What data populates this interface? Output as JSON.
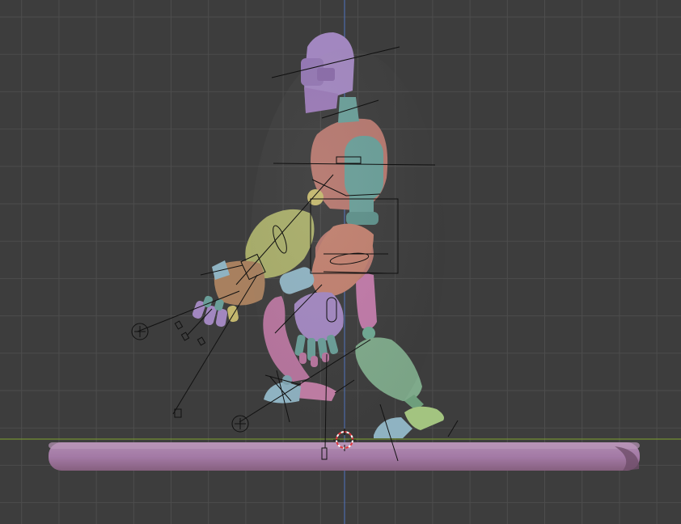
{
  "viewport": {
    "type": "3d-viewport",
    "view": "side-orthographic",
    "grid": true,
    "objects": [
      {
        "name": "robot-character",
        "icon": "armature"
      },
      {
        "name": "display-platform"
      }
    ],
    "cursor": {
      "icon": "3d-cursor-icon"
    }
  },
  "colors": {
    "background": "#3d3d3d",
    "grid": "#4d4d4d",
    "z_axis": "#4f73c0",
    "y_axis": "#7fa32e",
    "purple": "#9e7ab5",
    "teal": "#6a9e98",
    "salmon": "#b5786f",
    "olive": "#a8ad6a",
    "tan": "#a8805f",
    "pink": "#b7759e",
    "lilac": "#a287c0",
    "sky": "#8fb3c2",
    "green": "#7faa8b",
    "lime": "#a3c480",
    "platform": "#a47aa6"
  }
}
